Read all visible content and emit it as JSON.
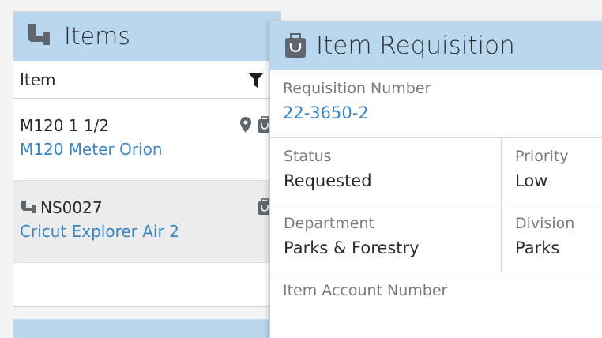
{
  "items_panel": {
    "title": "Items",
    "column_label": "Item",
    "rows": [
      {
        "code": "M120 1 1/2",
        "name": "M120 Meter Orion"
      },
      {
        "code": "NS0027",
        "name": "Cricut Explorer Air 2"
      }
    ]
  },
  "requisition": {
    "title": "Item Requisition",
    "number_label": "Requisition Number",
    "number_value": "22-3650-2",
    "status_label": "Status",
    "status_value": "Requested",
    "priority_label": "Priority",
    "priority_value": "Low",
    "department_label": "Department",
    "department_value": "Parks & Forestry",
    "division_label": "Division",
    "division_value": "Parks",
    "account_label": "Item Account Number"
  },
  "colors": {
    "header_bg": "#b9d7ee",
    "link": "#3a86c4",
    "icon": "#5f666d"
  },
  "icons": [
    "pipe-icon",
    "filter-icon",
    "location-pin-icon",
    "bag-icon"
  ]
}
